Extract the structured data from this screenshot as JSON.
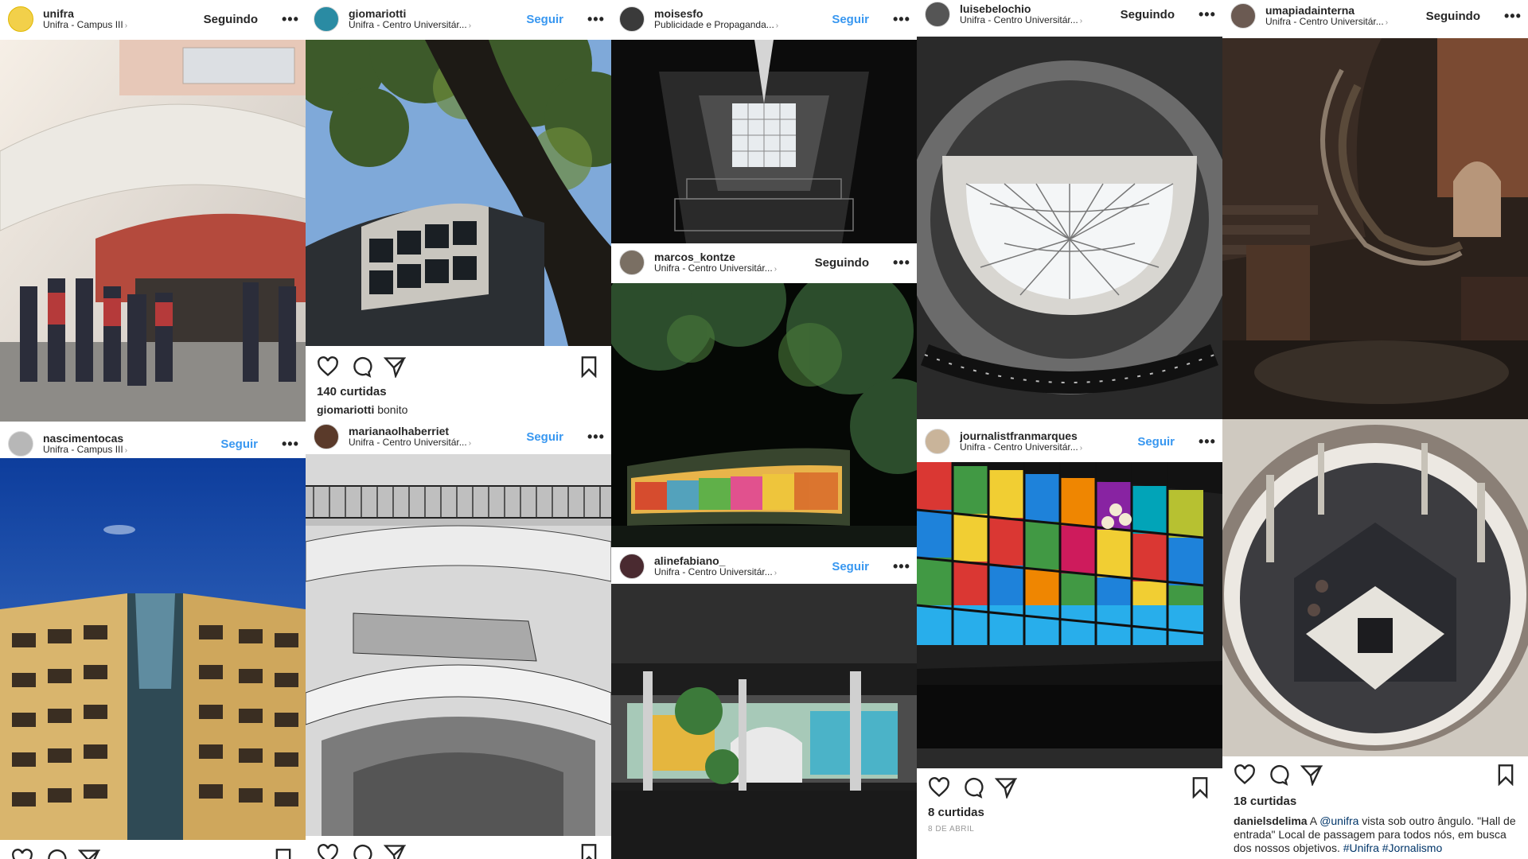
{
  "posts": {
    "p1": {
      "username": "unifra",
      "location": "Unifra - Campus III",
      "follow": "Seguindo"
    },
    "p2": {
      "username": "nascimentocas",
      "location": "Unifra - Campus III",
      "follow": "Seguir"
    },
    "p3": {
      "username": "giomariotti",
      "location": "Unifra - Centro Universitár...",
      "follow": "Seguir",
      "likes": "140 curtidas",
      "caption_user": "giomariotti",
      "caption_text": "bonito"
    },
    "p4": {
      "username": "marianaolhaberriet",
      "location": "Unifra - Centro Universitár...",
      "follow": "Seguir"
    },
    "p5": {
      "username": "moisesfo",
      "location": "Publicidade e Propaganda...",
      "follow": "Seguir"
    },
    "p6": {
      "username": "marcos_kontze",
      "location": "Unifra - Centro Universitár...",
      "follow": "Seguindo"
    },
    "p7": {
      "username": "alinefabiano_",
      "location": "Unifra - Centro Universitár...",
      "follow": "Seguir"
    },
    "p8": {
      "username": "luisebelochio",
      "location": "Unifra - Centro Universitár...",
      "follow": "Seguindo"
    },
    "p9": {
      "username": "journalistfranmarques",
      "location": "Unifra - Centro Universitár...",
      "follow": "Seguir",
      "likes": "8 curtidas",
      "timestamp": "8 DE ABRIL"
    },
    "p10": {
      "username": "umapiadainterna",
      "location": "Unifra - Centro Universitár...",
      "follow": "Seguindo"
    },
    "p11": {
      "likes": "18 curtidas",
      "caption_user": "danielsdelima",
      "caption_pre": "A ",
      "caption_mention": "@unifra",
      "caption_mid": " vista sob outro ângulo. \"Hall de entrada\" Local de passagem para todos nós, em busca dos nossos objetivos. ",
      "caption_tags": "#Unifra #Jornalismo"
    }
  },
  "icons": {
    "like": "heart-icon",
    "comment": "comment-icon",
    "share": "share-icon",
    "save": "bookmark-icon",
    "more": "more-options-icon",
    "chevron": "chevron-right-icon"
  },
  "colors": {
    "follow_blue": "#3897f0",
    "text": "#262626",
    "muted": "#999999"
  },
  "glyphs": {
    "more": "•••",
    "chevron": "›"
  }
}
